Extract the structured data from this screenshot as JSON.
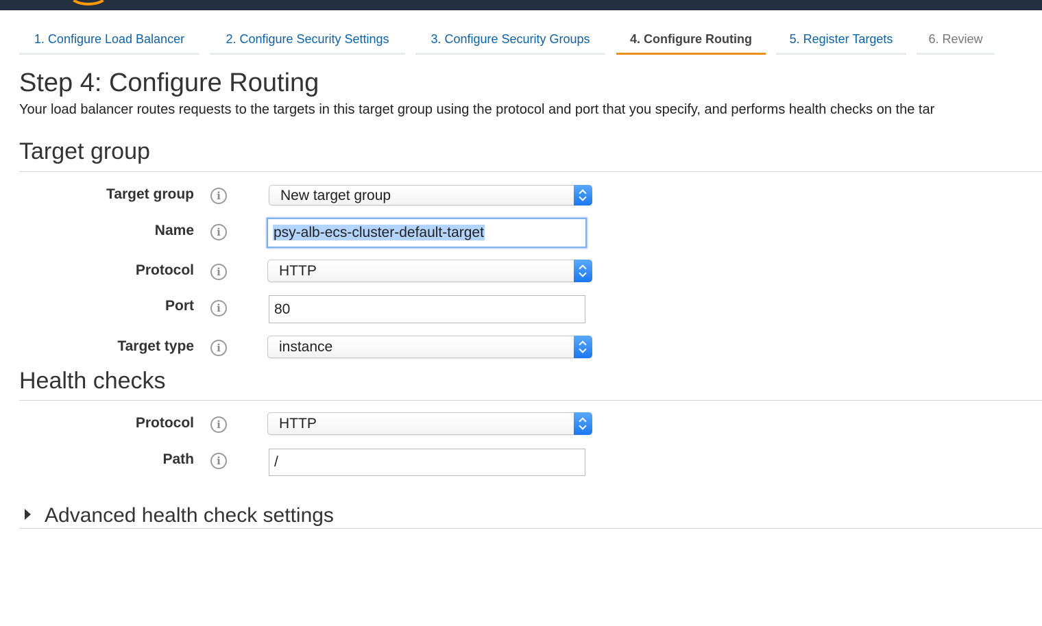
{
  "wizard": {
    "tabs": [
      {
        "label": "1. Configure Load Balancer"
      },
      {
        "label": "2. Configure Security Settings"
      },
      {
        "label": "3. Configure Security Groups"
      },
      {
        "label": "4. Configure Routing"
      },
      {
        "label": "5. Register Targets"
      },
      {
        "label": "6. Review"
      }
    ],
    "active_tab": "4. Configure Routing"
  },
  "page": {
    "title": "Step 4: Configure Routing",
    "description": "Your load balancer routes requests to the targets in this target group using the protocol and port that you specify, and performs health checks on the tar"
  },
  "target_group_section": {
    "heading": "Target group",
    "fields": {
      "target_group": {
        "label": "Target group",
        "value": "New target group"
      },
      "name": {
        "label": "Name",
        "value": "psy-alb-ecs-cluster-default-target"
      },
      "protocol": {
        "label": "Protocol",
        "value": "HTTP"
      },
      "port": {
        "label": "Port",
        "value": "80"
      },
      "target_type": {
        "label": "Target type",
        "value": "instance"
      }
    }
  },
  "health_checks_section": {
    "heading": "Health checks",
    "fields": {
      "protocol": {
        "label": "Protocol",
        "value": "HTTP"
      },
      "path": {
        "label": "Path",
        "value": "/"
      }
    }
  },
  "advanced": {
    "label": "Advanced health check settings"
  },
  "icons": {
    "info": "info-icon",
    "stepper": "select-stepper-icon",
    "expand": "caret-right-icon"
  },
  "colors": {
    "link": "#0f63a5",
    "active_tab_underline": "#f0901c",
    "header_bar": "#232f3e",
    "select_stepper": "#1a78f0",
    "text_selection": "#b3d4fc"
  }
}
